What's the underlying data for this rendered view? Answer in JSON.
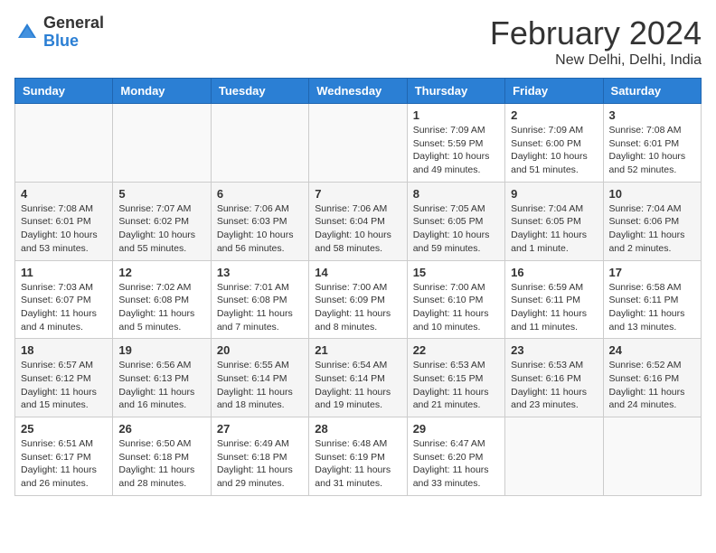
{
  "header": {
    "logo": {
      "general": "General",
      "blue": "Blue"
    },
    "title": "February 2024",
    "location": "New Delhi, Delhi, India"
  },
  "days_of_week": [
    "Sunday",
    "Monday",
    "Tuesday",
    "Wednesday",
    "Thursday",
    "Friday",
    "Saturday"
  ],
  "weeks": [
    [
      {
        "day": "",
        "info": ""
      },
      {
        "day": "",
        "info": ""
      },
      {
        "day": "",
        "info": ""
      },
      {
        "day": "",
        "info": ""
      },
      {
        "day": "1",
        "info": "Sunrise: 7:09 AM\nSunset: 5:59 PM\nDaylight: 10 hours\nand 49 minutes."
      },
      {
        "day": "2",
        "info": "Sunrise: 7:09 AM\nSunset: 6:00 PM\nDaylight: 10 hours\nand 51 minutes."
      },
      {
        "day": "3",
        "info": "Sunrise: 7:08 AM\nSunset: 6:01 PM\nDaylight: 10 hours\nand 52 minutes."
      }
    ],
    [
      {
        "day": "4",
        "info": "Sunrise: 7:08 AM\nSunset: 6:01 PM\nDaylight: 10 hours\nand 53 minutes."
      },
      {
        "day": "5",
        "info": "Sunrise: 7:07 AM\nSunset: 6:02 PM\nDaylight: 10 hours\nand 55 minutes."
      },
      {
        "day": "6",
        "info": "Sunrise: 7:06 AM\nSunset: 6:03 PM\nDaylight: 10 hours\nand 56 minutes."
      },
      {
        "day": "7",
        "info": "Sunrise: 7:06 AM\nSunset: 6:04 PM\nDaylight: 10 hours\nand 58 minutes."
      },
      {
        "day": "8",
        "info": "Sunrise: 7:05 AM\nSunset: 6:05 PM\nDaylight: 10 hours\nand 59 minutes."
      },
      {
        "day": "9",
        "info": "Sunrise: 7:04 AM\nSunset: 6:05 PM\nDaylight: 11 hours\nand 1 minute."
      },
      {
        "day": "10",
        "info": "Sunrise: 7:04 AM\nSunset: 6:06 PM\nDaylight: 11 hours\nand 2 minutes."
      }
    ],
    [
      {
        "day": "11",
        "info": "Sunrise: 7:03 AM\nSunset: 6:07 PM\nDaylight: 11 hours\nand 4 minutes."
      },
      {
        "day": "12",
        "info": "Sunrise: 7:02 AM\nSunset: 6:08 PM\nDaylight: 11 hours\nand 5 minutes."
      },
      {
        "day": "13",
        "info": "Sunrise: 7:01 AM\nSunset: 6:08 PM\nDaylight: 11 hours\nand 7 minutes."
      },
      {
        "day": "14",
        "info": "Sunrise: 7:00 AM\nSunset: 6:09 PM\nDaylight: 11 hours\nand 8 minutes."
      },
      {
        "day": "15",
        "info": "Sunrise: 7:00 AM\nSunset: 6:10 PM\nDaylight: 11 hours\nand 10 minutes."
      },
      {
        "day": "16",
        "info": "Sunrise: 6:59 AM\nSunset: 6:11 PM\nDaylight: 11 hours\nand 11 minutes."
      },
      {
        "day": "17",
        "info": "Sunrise: 6:58 AM\nSunset: 6:11 PM\nDaylight: 11 hours\nand 13 minutes."
      }
    ],
    [
      {
        "day": "18",
        "info": "Sunrise: 6:57 AM\nSunset: 6:12 PM\nDaylight: 11 hours\nand 15 minutes."
      },
      {
        "day": "19",
        "info": "Sunrise: 6:56 AM\nSunset: 6:13 PM\nDaylight: 11 hours\nand 16 minutes."
      },
      {
        "day": "20",
        "info": "Sunrise: 6:55 AM\nSunset: 6:14 PM\nDaylight: 11 hours\nand 18 minutes."
      },
      {
        "day": "21",
        "info": "Sunrise: 6:54 AM\nSunset: 6:14 PM\nDaylight: 11 hours\nand 19 minutes."
      },
      {
        "day": "22",
        "info": "Sunrise: 6:53 AM\nSunset: 6:15 PM\nDaylight: 11 hours\nand 21 minutes."
      },
      {
        "day": "23",
        "info": "Sunrise: 6:53 AM\nSunset: 6:16 PM\nDaylight: 11 hours\nand 23 minutes."
      },
      {
        "day": "24",
        "info": "Sunrise: 6:52 AM\nSunset: 6:16 PM\nDaylight: 11 hours\nand 24 minutes."
      }
    ],
    [
      {
        "day": "25",
        "info": "Sunrise: 6:51 AM\nSunset: 6:17 PM\nDaylight: 11 hours\nand 26 minutes."
      },
      {
        "day": "26",
        "info": "Sunrise: 6:50 AM\nSunset: 6:18 PM\nDaylight: 11 hours\nand 28 minutes."
      },
      {
        "day": "27",
        "info": "Sunrise: 6:49 AM\nSunset: 6:18 PM\nDaylight: 11 hours\nand 29 minutes."
      },
      {
        "day": "28",
        "info": "Sunrise: 6:48 AM\nSunset: 6:19 PM\nDaylight: 11 hours\nand 31 minutes."
      },
      {
        "day": "29",
        "info": "Sunrise: 6:47 AM\nSunset: 6:20 PM\nDaylight: 11 hours\nand 33 minutes."
      },
      {
        "day": "",
        "info": ""
      },
      {
        "day": "",
        "info": ""
      }
    ]
  ]
}
